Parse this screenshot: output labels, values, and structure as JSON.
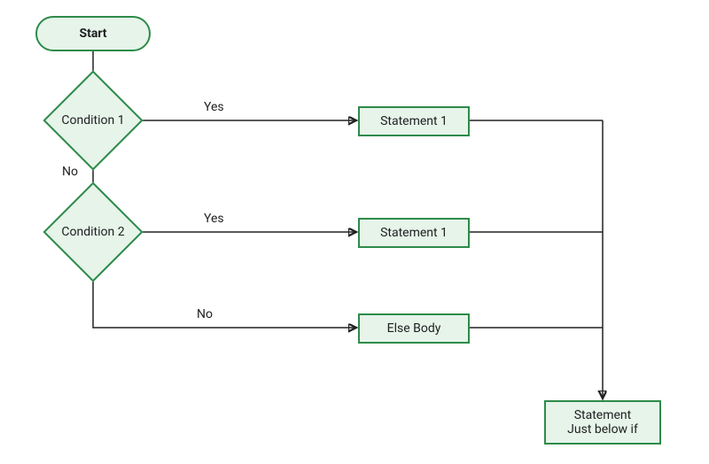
{
  "nodes": {
    "start": "Start",
    "condition1": "Condition 1",
    "condition2": "Condition 2",
    "statement1a": "Statement 1",
    "statement1b": "Statement 1",
    "elseBody": "Else Body",
    "final": "Statement\nJust below if"
  },
  "edges": {
    "cond1_yes": "Yes",
    "cond1_no": "No",
    "cond2_yes": "Yes",
    "cond2_no": "No"
  },
  "diagram": {
    "type": "flowchart",
    "description": "if-elif-else control flow",
    "sequence": [
      {
        "node": "Start",
        "to": "Condition 1"
      },
      {
        "node": "Condition 1",
        "type": "decision",
        "yes": "Statement 1",
        "no": "Condition 2"
      },
      {
        "node": "Condition 2",
        "type": "decision",
        "yes": "Statement 1",
        "no": "Else Body"
      },
      {
        "note": "All branches converge to 'Statement Just below if'"
      }
    ]
  },
  "colors": {
    "border": "#2d8b49",
    "fill": "#e6f4ea",
    "line": "#222222"
  }
}
